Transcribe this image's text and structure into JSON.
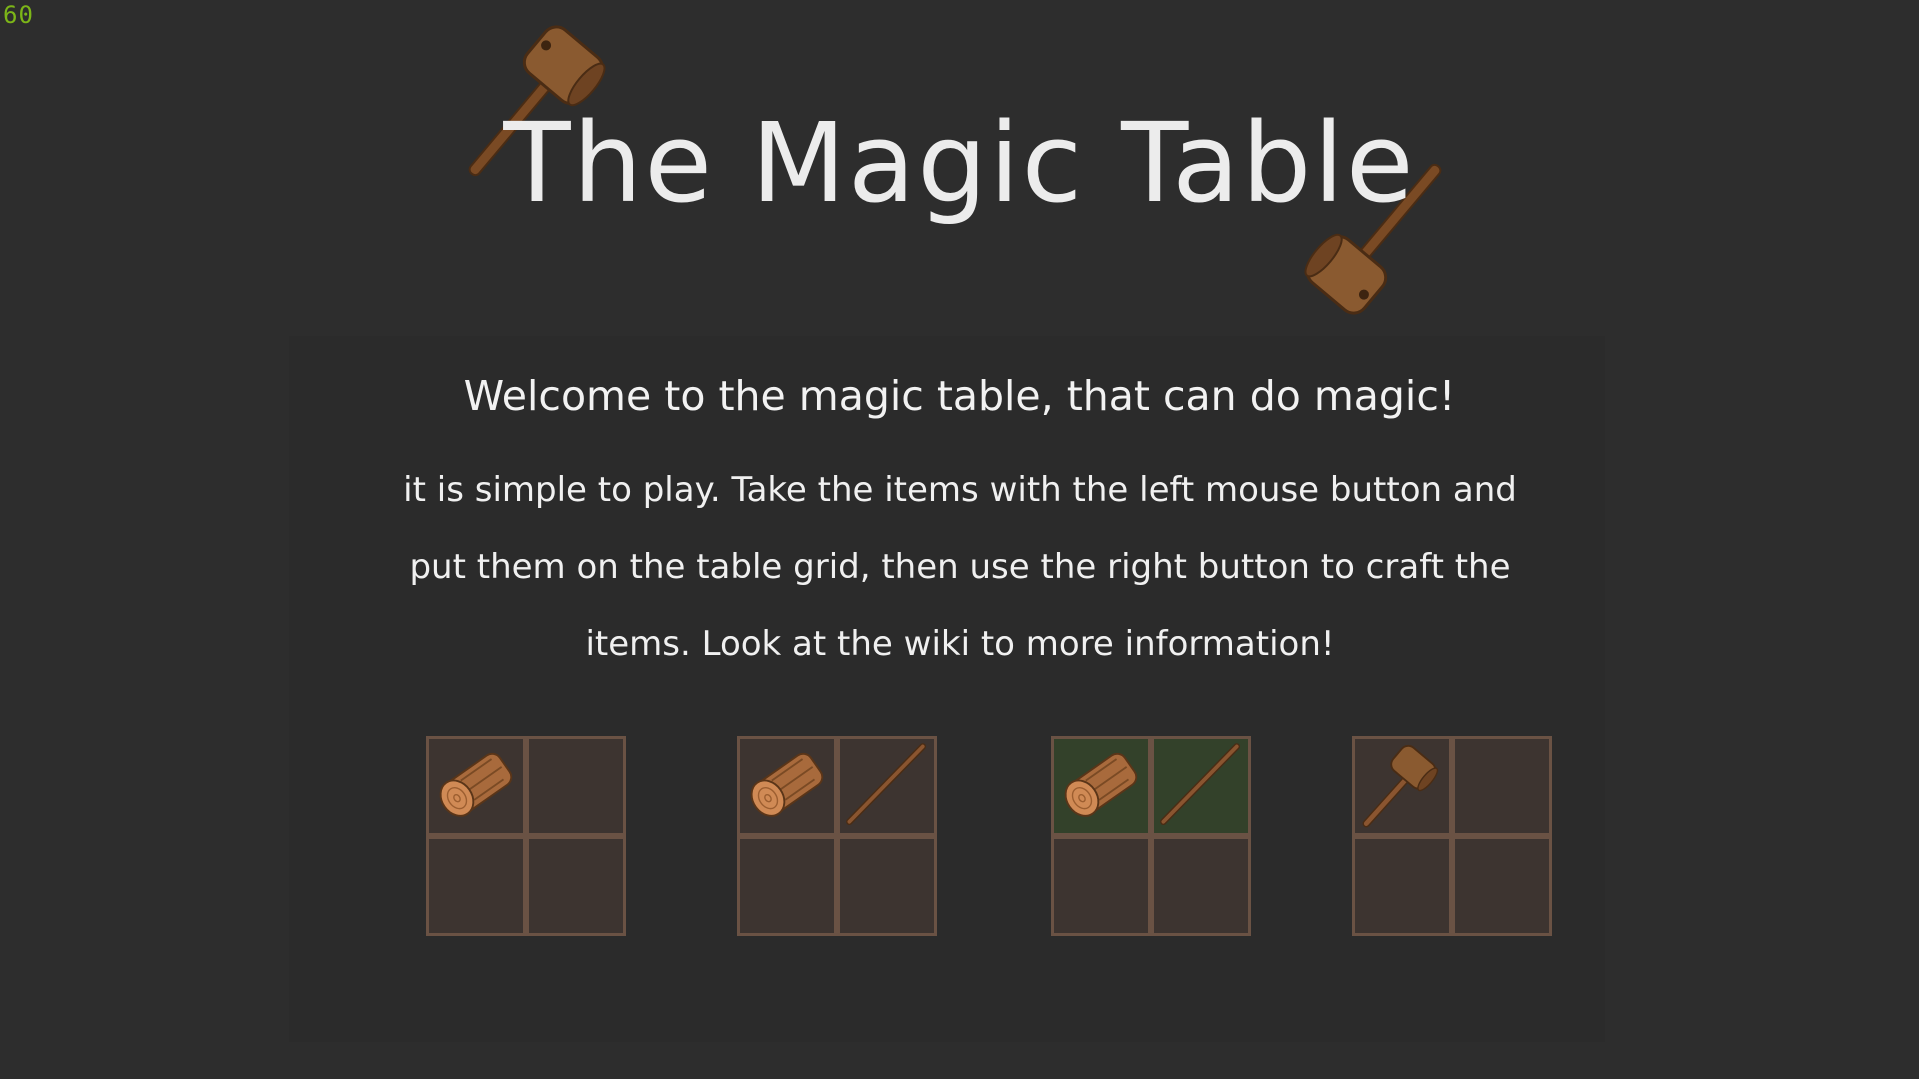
{
  "fps": "60",
  "title": "The Magic Table",
  "welcome": "Welcome to the magic table, that can do magic!",
  "instructions": "it is simple to play. Take the items with the left mouse button and put them on the table grid, then use the right button to craft the items. Look at the wiki to more information!",
  "colors": {
    "background": "#2d2d2d",
    "fps": "#7cb518",
    "grid_border": "#6a5244",
    "cell": "#3d3430",
    "cell_highlight": "#33412a"
  },
  "grids": [
    {
      "cells": [
        "log-icon",
        "",
        "",
        ""
      ],
      "highlighted": [
        false,
        false,
        false,
        false
      ]
    },
    {
      "cells": [
        "log-icon",
        "stick-icon",
        "",
        ""
      ],
      "highlighted": [
        false,
        false,
        false,
        false
      ]
    },
    {
      "cells": [
        "log-icon",
        "stick-icon",
        "",
        ""
      ],
      "highlighted": [
        true,
        true,
        false,
        false
      ]
    },
    {
      "cells": [
        "hammer-icon",
        "",
        "",
        ""
      ],
      "highlighted": [
        false,
        false,
        false,
        false
      ]
    }
  ]
}
